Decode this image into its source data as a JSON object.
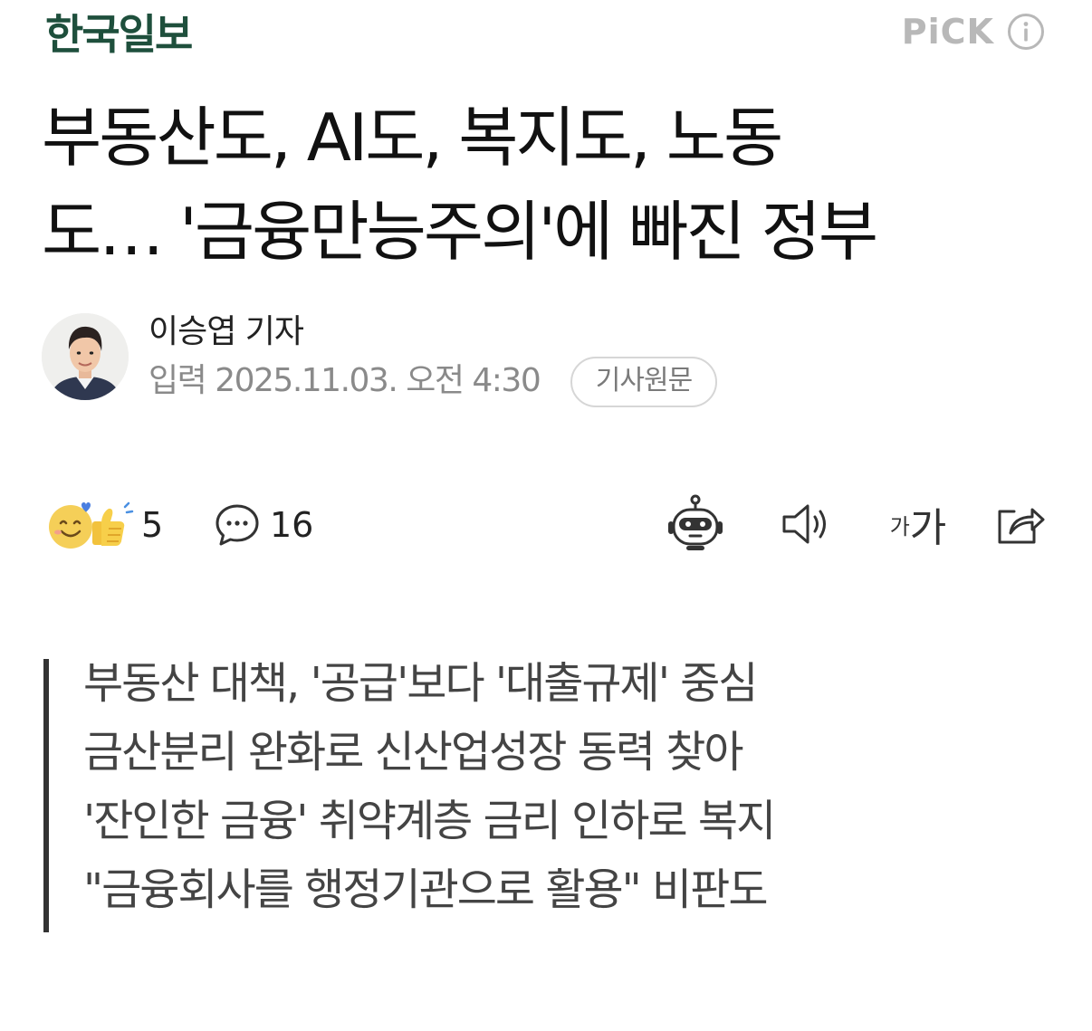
{
  "header": {
    "press_name": "한국일보",
    "pick_label": "PiCK"
  },
  "article": {
    "headline_line1": "부동산도, AI도, 복지도, 노동",
    "headline_line2": "도… '금융만능주의'에 빠진 정부"
  },
  "byline": {
    "reporter": "이승엽 기자",
    "date_label": "입력",
    "date_value": "2025.11.03. 오전 4:30",
    "original_button": "기사원문"
  },
  "actions": {
    "reaction_count": "5",
    "comment_count": "16",
    "font_small": "가",
    "font_large": "가"
  },
  "summary": {
    "lines": [
      "부동산 대책, '공급'보다 '대출규제' 중심",
      "금산분리 완화로 신산업성장 동력 찾아",
      "'잔인한 금융' 취약계층 금리 인하로 복지",
      "\"금융회사를 행정기관으로 활용\" 비판도"
    ]
  },
  "colors": {
    "logo": "#1e4f3c",
    "pick": "#b8b8b8",
    "summary_bar": "#333333",
    "muted": "#8a8a8a"
  },
  "icons": {
    "info": "info-icon",
    "reaction": "smile-thumbs-up-icon",
    "comment": "speech-bubble-icon",
    "robot": "robot-icon",
    "speaker": "speaker-icon",
    "share": "share-icon"
  }
}
